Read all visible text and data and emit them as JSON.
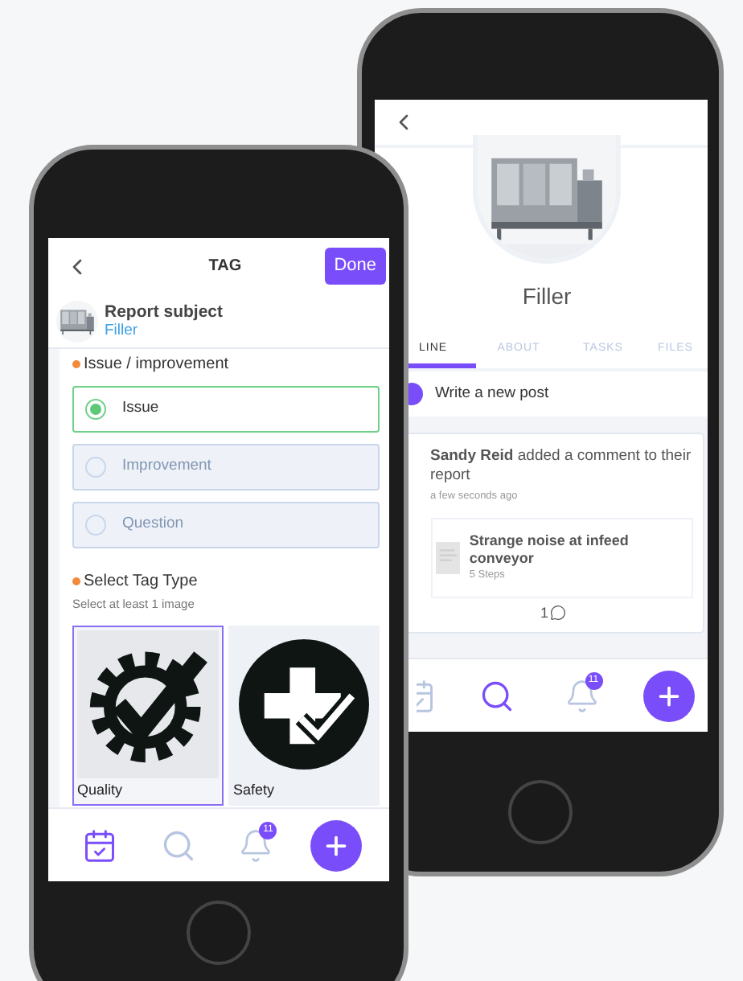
{
  "back_phone": {
    "profile": {
      "name": "Filler"
    },
    "tabs": [
      {
        "label": "LINE",
        "selected": true
      },
      {
        "label": "ABOUT",
        "selected": false
      },
      {
        "label": "TASKS",
        "selected": false
      },
      {
        "label": "FILES",
        "selected": false
      }
    ],
    "composer": {
      "placeholder": "Write a new post"
    },
    "feed": [
      {
        "text": "**Sandy Reid** added a comment to their report",
        "time": "a few seconds ago",
        "attachment": {
          "title": "Strange noise at infeed conveyor",
          "subtitle": "5 Steps"
        },
        "comment_count": "1"
      }
    ],
    "nav": [
      {
        "kind": "calendar",
        "selected": false
      },
      {
        "kind": "search",
        "selected": true
      },
      {
        "kind": "bell",
        "selected": false,
        "badge": "11"
      },
      {
        "kind": "add",
        "selected": false
      }
    ]
  },
  "front_phone": {
    "header": {
      "title": "TAG",
      "action": "Done"
    },
    "subject": {
      "label": "Report subject",
      "value": "Filler"
    },
    "issue_type": {
      "label": "Issue / improvement",
      "required": true,
      "options": [
        {
          "label": "Issue",
          "selected": true
        },
        {
          "label": "Improvement",
          "selected": false
        },
        {
          "label": "Question",
          "selected": false
        }
      ]
    },
    "tag_type": {
      "label": "Select Tag Type",
      "hint": "Select at least 1 image",
      "required": true,
      "tiles": [
        {
          "kind": "quality",
          "label": "Quality",
          "selected": true
        },
        {
          "kind": "safety",
          "label": "Safety",
          "selected": false
        }
      ]
    },
    "nav": [
      {
        "kind": "calendar",
        "selected": true
      },
      {
        "kind": "search",
        "selected": false
      },
      {
        "kind": "bell",
        "selected": false,
        "badge": "11"
      },
      {
        "kind": "add",
        "selected": false
      }
    ]
  }
}
